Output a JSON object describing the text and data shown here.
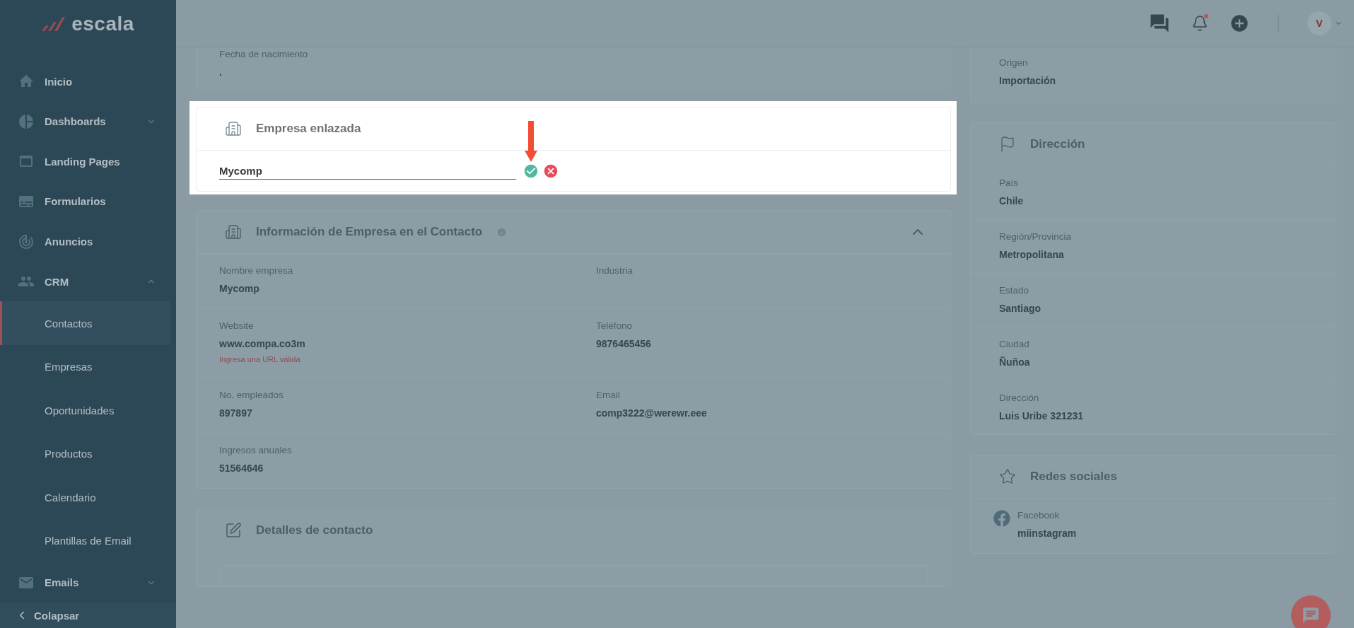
{
  "sidebar": {
    "logo": "escala",
    "items": [
      {
        "label": "Inicio",
        "kind": "link",
        "selected": false
      },
      {
        "label": "Dashboards",
        "kind": "group",
        "selected": false,
        "expanded": false
      },
      {
        "label": "Landing Pages",
        "kind": "link",
        "selected": false
      },
      {
        "label": "Formularios",
        "kind": "link",
        "selected": false
      },
      {
        "label": "Anuncios",
        "kind": "link",
        "selected": false
      },
      {
        "label": "CRM",
        "kind": "group",
        "selected": false,
        "expanded": true,
        "children": [
          {
            "label": "Contactos",
            "selected": true
          },
          {
            "label": "Empresas",
            "selected": false
          },
          {
            "label": "Oportunidades",
            "selected": false
          },
          {
            "label": "Productos",
            "selected": false
          },
          {
            "label": "Calendario",
            "selected": false
          },
          {
            "label": "Plantillas de Email",
            "selected": false
          }
        ]
      },
      {
        "label": "Emails",
        "kind": "group",
        "selected": false,
        "expanded": false
      }
    ],
    "collapse": "Colapsar"
  },
  "header": {
    "notifications_unread": true,
    "avatar": "V"
  },
  "birth_date": {
    "label": "Fecha de nacimiento",
    "value": "."
  },
  "linked_company": {
    "title": "Empresa enlazada",
    "input_value": "Mycomp",
    "highlighted": true,
    "callout_arrow": true
  },
  "company_info": {
    "title": "Información de Empresa en el Contacto",
    "expanded": true,
    "fields": [
      {
        "label": "Nombre empresa",
        "value": "Mycomp"
      },
      {
        "label": "Industria"
      },
      {
        "label": "Website",
        "value": "www.compa.co3m",
        "error": "Ingresa una URL válida"
      },
      {
        "label": "Teléfono",
        "value": "9876465456"
      },
      {
        "label": "No. empleados",
        "value": "897897"
      },
      {
        "label": "Email",
        "value": "comp3222@werewr.eee"
      },
      {
        "label": "Ingresos anuales",
        "value": "51564646"
      }
    ]
  },
  "contact_details": {
    "title": "Detalles de contacto"
  },
  "origin": {
    "label": "Origen",
    "value": "Importación"
  },
  "address": {
    "title": "Dirección",
    "fields": [
      {
        "label": "País",
        "value": "Chile"
      },
      {
        "label": "Región/Provincia",
        "value": "Metropolitana"
      },
      {
        "label": "Estado",
        "value": "Santiago"
      },
      {
        "label": "Ciudad",
        "value": "Ñuñoa"
      },
      {
        "label": "Dirección",
        "value": "Luis Uribe 321231"
      }
    ]
  },
  "social": {
    "title": "Redes sociales",
    "items": [
      {
        "network": "Facebook",
        "value": "miinstagram"
      }
    ]
  }
}
